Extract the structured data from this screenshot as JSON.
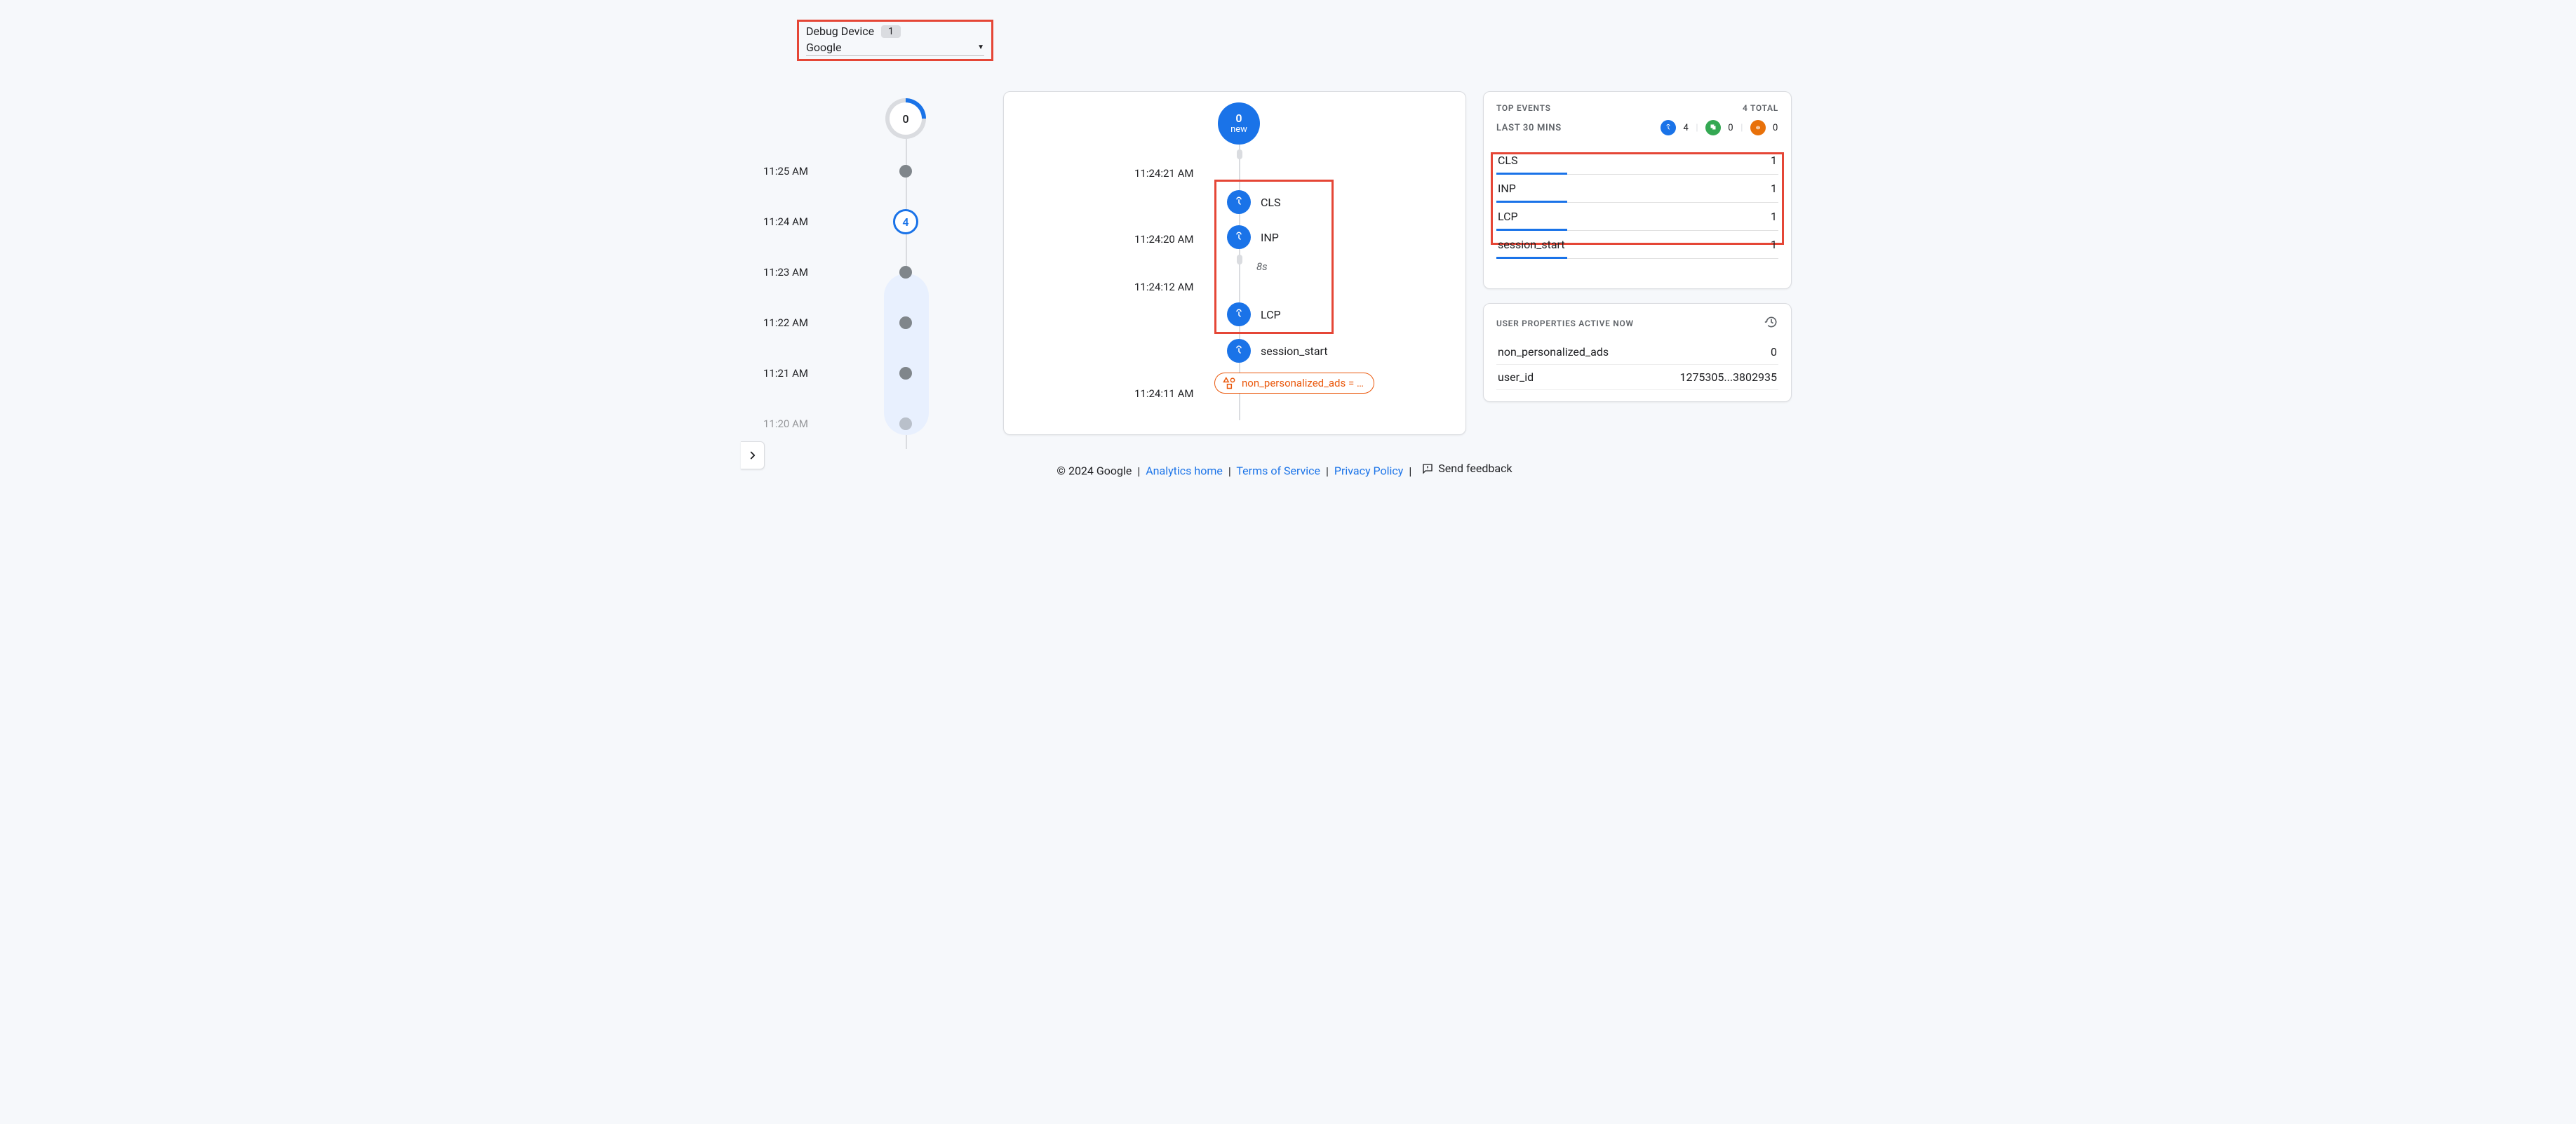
{
  "debug_device": {
    "label": "Debug Device",
    "count": "1",
    "value": "Google"
  },
  "minute_timeline": {
    "big_value": "0",
    "minutes": [
      {
        "label": "11:25 AM",
        "active": false,
        "count": null
      },
      {
        "label": "11:24 AM",
        "active": true,
        "count": "4"
      },
      {
        "label": "11:23 AM",
        "active": false,
        "count": null
      },
      {
        "label": "11:22 AM",
        "active": false,
        "count": null
      },
      {
        "label": "11:21 AM",
        "active": false,
        "count": null
      },
      {
        "label": "11:20 AM",
        "active": false,
        "count": null,
        "faded": true
      }
    ]
  },
  "stream": {
    "new_badge": {
      "count": "0",
      "label": "new"
    },
    "timestamps": {
      "t1": "11:24:21 AM",
      "t2": "11:24:20 AM",
      "t3": "11:24:12 AM",
      "t4": "11:24:11 AM"
    },
    "gap_label": "8s",
    "events": [
      {
        "name": "CLS",
        "icon": "touch"
      },
      {
        "name": "INP",
        "icon": "touch"
      },
      {
        "name": "LCP",
        "icon": "touch"
      },
      {
        "name": "session_start",
        "icon": "touch"
      }
    ],
    "property_chip": "non_personalized_ads = …"
  },
  "top_events": {
    "title": "TOP EVENTS",
    "total_label": "4 TOTAL",
    "sub_label": "LAST 30 MINS",
    "icon_counts": {
      "touch": "4",
      "flag": "0",
      "bug": "0"
    },
    "rows": [
      {
        "name": "CLS",
        "count": "1",
        "bar_pct": 25
      },
      {
        "name": "INP",
        "count": "1",
        "bar_pct": 25
      },
      {
        "name": "LCP",
        "count": "1",
        "bar_pct": 25
      },
      {
        "name": "session_start",
        "count": "1",
        "bar_pct": 25
      }
    ]
  },
  "user_properties": {
    "title": "USER PROPERTIES ACTIVE NOW",
    "rows": [
      {
        "name": "non_personalized_ads",
        "value": "0"
      },
      {
        "name": "user_id",
        "value": "1275305...3802935"
      }
    ]
  },
  "footer": {
    "copyright": "© 2024 Google",
    "links": {
      "analytics_home": "Analytics home",
      "tos": "Terms of Service",
      "privacy": "Privacy Policy"
    },
    "feedback": "Send feedback"
  }
}
